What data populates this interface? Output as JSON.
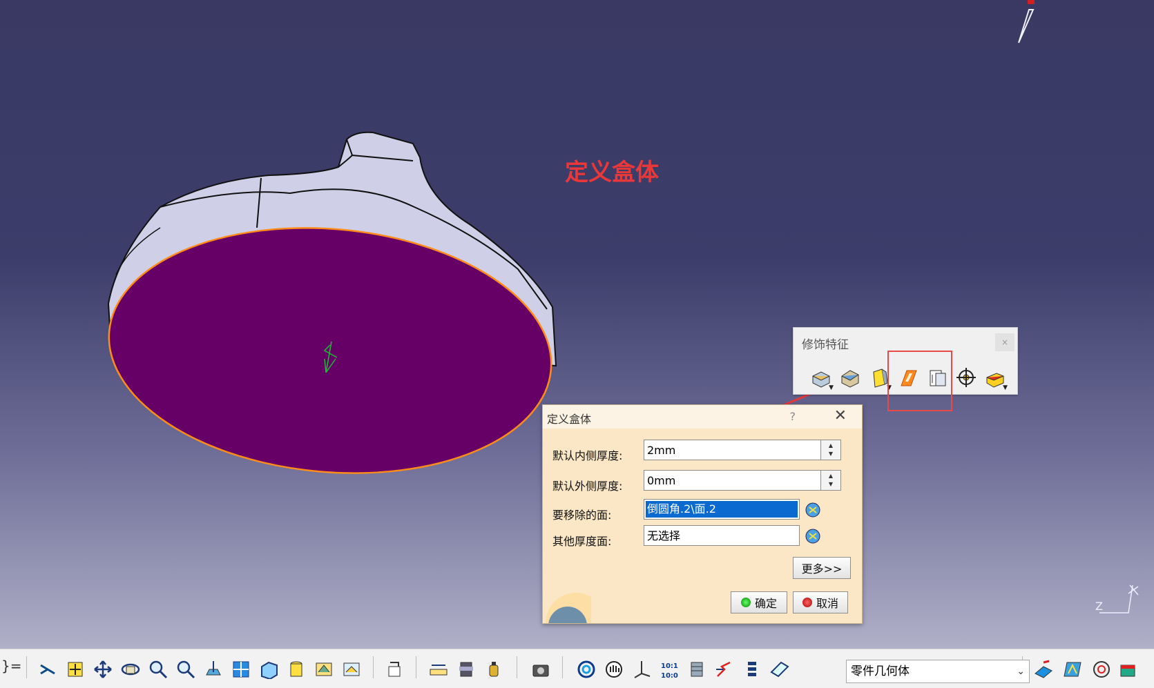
{
  "annotation": {
    "text": "定义盒体",
    "color": "#e8383a"
  },
  "floating_toolbar": {
    "title": "修饰特征",
    "close": "×",
    "icons": [
      "fillet-icon",
      "chamfer-icon",
      "draft-icon",
      "shell-icon",
      "thickness-icon",
      "thread-icon",
      "remove-face-icon"
    ]
  },
  "dialog": {
    "title": "定义盒体",
    "help": "?",
    "close": "✕",
    "fields": {
      "inner_label": "默认内侧厚度:",
      "inner_value": "2mm",
      "outer_label": "默认外侧厚度:",
      "outer_value": "0mm",
      "remove_label": "要移除的面:",
      "remove_value": "倒圆角.2\\面.2",
      "other_label": "其他厚度面:",
      "other_value": "无选择"
    },
    "more_button": "更多>>",
    "ok_button": "确定",
    "cancel_button": "取消"
  },
  "bottom_toolbar": {
    "body_select": "零件几何体",
    "icons": [
      "fly-mode-icon",
      "fit-all-icon",
      "pan-icon",
      "rotate-icon",
      "zoom-in-icon",
      "zoom-out-icon",
      "normal-view-icon",
      "multi-view-icon",
      "iso-view-icon",
      "shading-icon",
      "hide-show-icon",
      "swap-space-icon",
      "measure-icon",
      "measure-item-icon",
      "mass-icon",
      "capture-icon",
      "update-icon",
      "grab-icon",
      "axis-icon",
      "scale-icon",
      "body-icon",
      "constraint-icon",
      "tree-icon",
      "plane-icon",
      "sketch-icon",
      "surface-icon",
      "analysis-icon",
      "compass-icon"
    ]
  },
  "colors": {
    "face": "#660066",
    "edge_highlight": "#ff8c1a",
    "dialog_bg": "#fbe7c5",
    "selection": "#0a6ad0"
  }
}
